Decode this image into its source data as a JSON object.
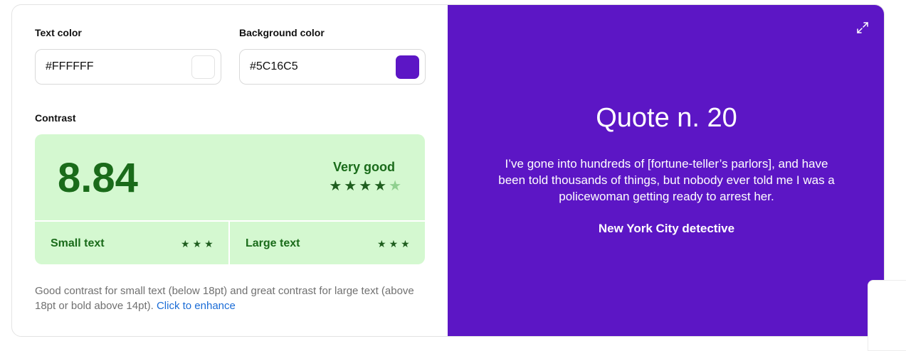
{
  "text_color": {
    "label": "Text color",
    "value": "#FFFFFF",
    "swatch": "#FFFFFF"
  },
  "background_color": {
    "label": "Background color",
    "value": "#5C16C5",
    "swatch": "#5C16C5"
  },
  "contrast": {
    "label": "Contrast",
    "ratio": "8.84",
    "rating": "Very good",
    "stars_filled": 4,
    "stars_total": 5,
    "small_text": {
      "label": "Small text",
      "stars": 3
    },
    "large_text": {
      "label": "Large text",
      "stars": 3
    }
  },
  "description": {
    "text": "Good contrast for small text (below 18pt) and great contrast for large text (above 18pt or bold above 14pt).",
    "link": "Click to enhance"
  },
  "preview": {
    "title": "Quote n. 20",
    "body": "I’ve gone into hundreds of [fortune-teller’s parlors], and have been told thousands of things, but nobody ever told me I was a policewoman getting ready to arrest her.",
    "author": "New York City detective",
    "expand_icon": "expand-icon"
  },
  "colors": {
    "good_green": "#1a6b1a",
    "good_bg": "#d4f8d0",
    "link": "#1a6cd6"
  }
}
